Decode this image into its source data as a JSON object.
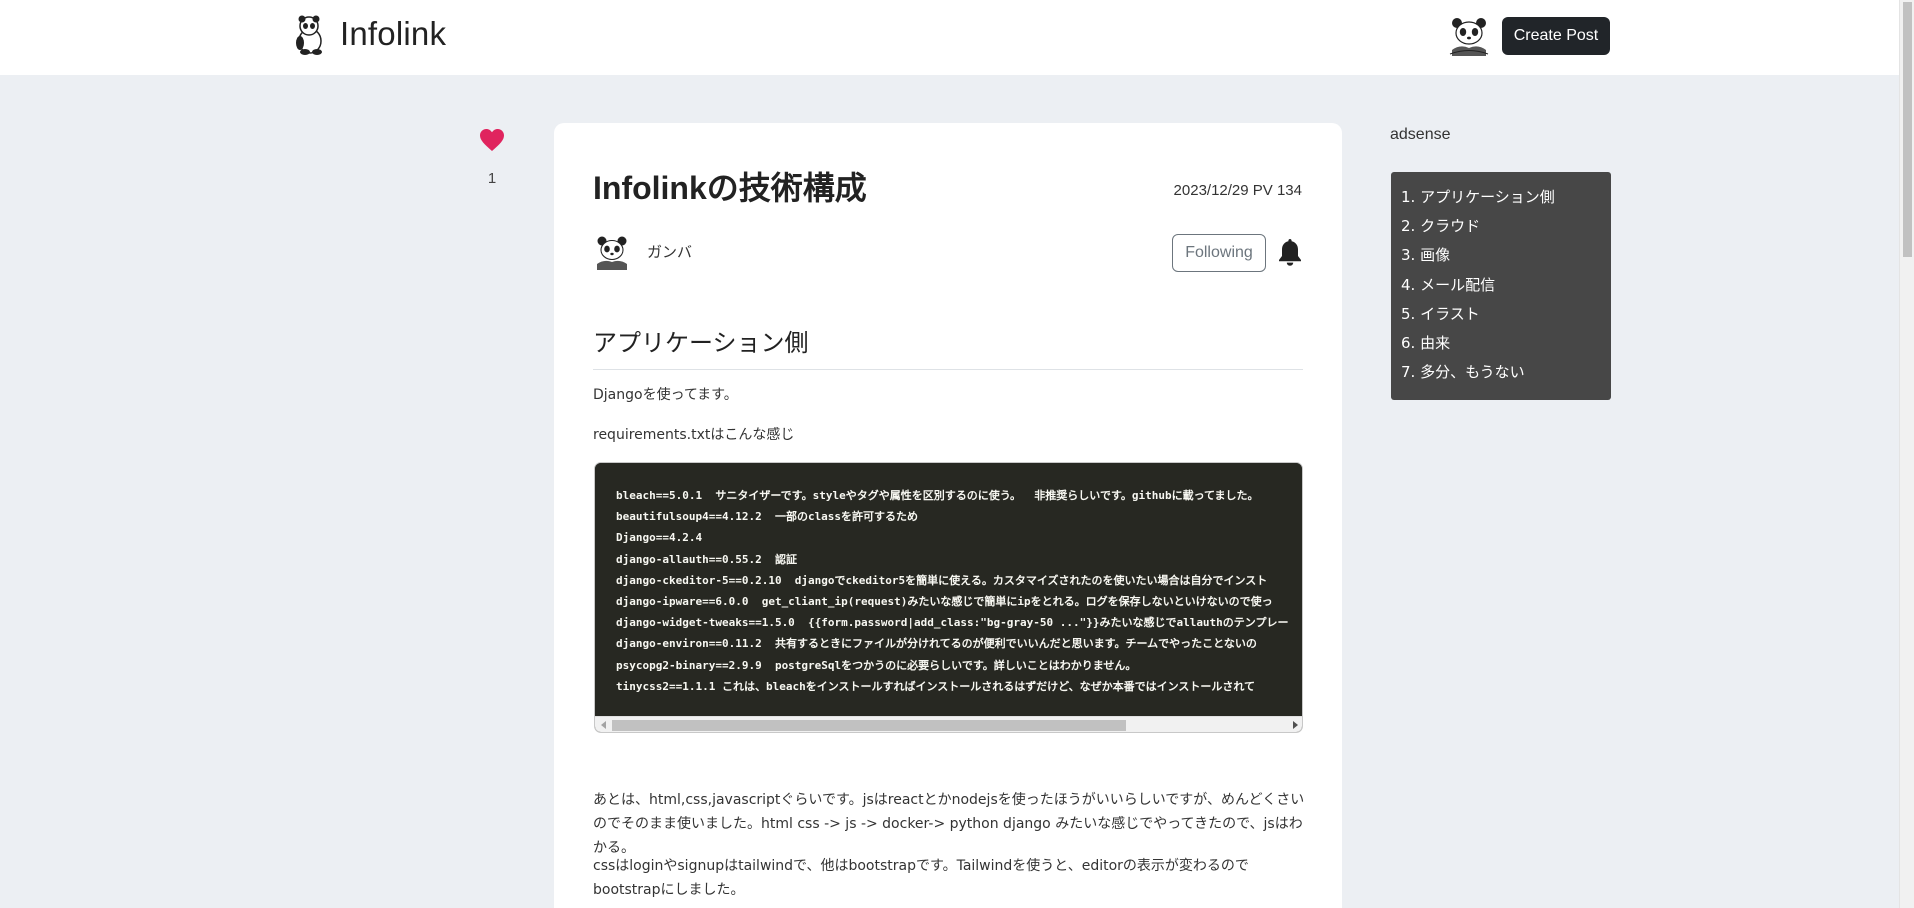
{
  "header": {
    "logo_text": "Infolink",
    "create_post_label": "Create Post"
  },
  "like": {
    "count": "1",
    "color": "#e0245e"
  },
  "article": {
    "title": "Infolinkの技術構成",
    "meta": "2023/12/29 PV 134",
    "author": "ガンバ",
    "follow_label": "Following",
    "section_heading": "アプリケーション側",
    "p1": "Djangoを使ってます。",
    "p2": "requirements.txtはこんな感じ",
    "code_lines": [
      "bleach==5.0.1  サニタイザーです。styleやタグや属性を区別するのに使う。  非推奨らしいです。githubに載ってました。",
      "beautifulsoup4==4.12.2  一部のclassを許可するため",
      "Django==4.2.4",
      "django-allauth==0.55.2  認証",
      "django-ckeditor-5==0.2.10  djangoでckeditor5を簡単に使える。カスタマイズされたのを使いたい場合は自分でインスト",
      "django-ipware==6.0.0  get_cliant_ip(request)みたいな感じで簡単にipをとれる。ログを保存しないといけないので使っ",
      "django-widget-tweaks==1.5.0  {{form.password|add_class:\"bg-gray-50 ...\"}}みたいな感じでallauthのテンプレー",
      "django-environ==0.11.2  共有するときにファイルが分けれてるのが便利でいいんだと思います。チームでやったことないの",
      "psycopg2-binary==2.9.9  postgreSqlをつかうのに必要らしいです。詳しいことはわかりません。",
      "tinycss2==1.1.1 これは、bleachをインストールすればインストールされるはずだけど、なぜか本番ではインストールされて"
    ],
    "p3": "あとは、html,css,javascriptぐらいです。jsはreactとかnodejsを使ったほうがいいらしいですが、めんどくさいのでそのまま使いました。html css -> js -> docker-> python django みたいな感じでやってきたので、jsはわかる。",
    "p4": "cssはloginやsignupはtailwindで、他はbootstrapです。Tailwindを使うと、editorの表示が変わるのでbootstrapにしました。"
  },
  "sidebar": {
    "ad_label": "adsense",
    "toc": [
      "1. アプリケーション側",
      "2. クラウド",
      "3. 画像",
      "4. メール配信",
      "5. イラスト",
      "6. 由来",
      "7. 多分、もうない"
    ]
  },
  "icons": {
    "logo": "panda-logo-icon",
    "avatar": "panda-avatar-icon",
    "like": "heart-icon",
    "bell": "bell-icon"
  }
}
